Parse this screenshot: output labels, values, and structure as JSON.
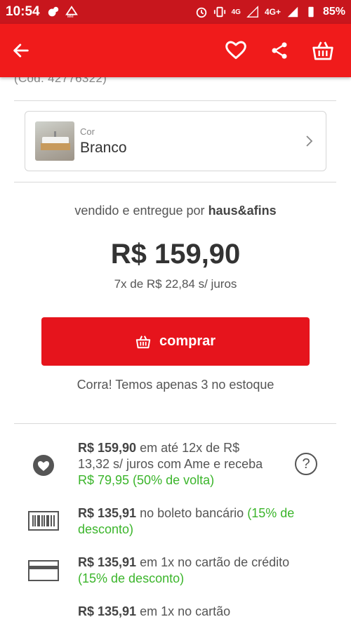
{
  "status_bar": {
    "time": "10:54",
    "network": "4G",
    "network2": "4G+",
    "battery": "85%"
  },
  "product": {
    "code": "(Cód. 42776322)",
    "variant_label": "Cor",
    "variant_value": "Branco",
    "seller_prefix": "vendido e entregue por",
    "seller_name": "haus&afins",
    "price": "R$ 159,90",
    "installments": "7x de R$ 22,84 s/ juros",
    "buy_label": "comprar",
    "stock_msg": "Corra! Temos apenas 3 no estoque"
  },
  "payment_options": [
    {
      "icon": "ame-heart-icon",
      "amount": "R$ 159,90",
      "line1_rest": " em até 12x de R$",
      "line2": "13,32 s/ juros com Ame e receba",
      "green": "R$ 79,95 (50% de volta)"
    },
    {
      "icon": "barcode-icon",
      "amount": "R$ 135,91",
      "line1_rest": " no boleto bancário ",
      "green1": "(15% de",
      "green2": "desconto)"
    },
    {
      "icon": "credit-card-icon",
      "amount": "R$ 135,91",
      "line1_rest": " em 1x no cartão de crédito",
      "green": "(15% de desconto)"
    },
    {
      "icon": "card-icon",
      "amount": "R$ 135,91",
      "line1_rest": " em 1x no cartão"
    }
  ],
  "colors": {
    "status_bar": "#c8161d",
    "app_bar": "#f01b1b",
    "buy_button": "#e6141c",
    "green": "#3bb52b"
  }
}
